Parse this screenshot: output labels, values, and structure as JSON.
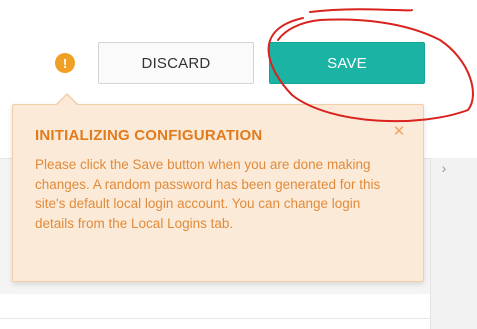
{
  "toolbar": {
    "warning_icon": "warning-icon",
    "discard_label": "DISCARD",
    "save_label": "SAVE"
  },
  "popover": {
    "title": "INITIALIZING CONFIGURATION",
    "close_icon": "close-icon",
    "message": "Please click the Save button when you are done making changes. A random password has been generated for this site's default local login account. You can change login details from the Local Logins tab."
  },
  "colors": {
    "save_button": "#1bb3a4",
    "popover_background": "#fcead8",
    "popover_title": "#e07b1e",
    "warning_icon": "#f0a125",
    "annotation_stroke": "#d9231f"
  }
}
